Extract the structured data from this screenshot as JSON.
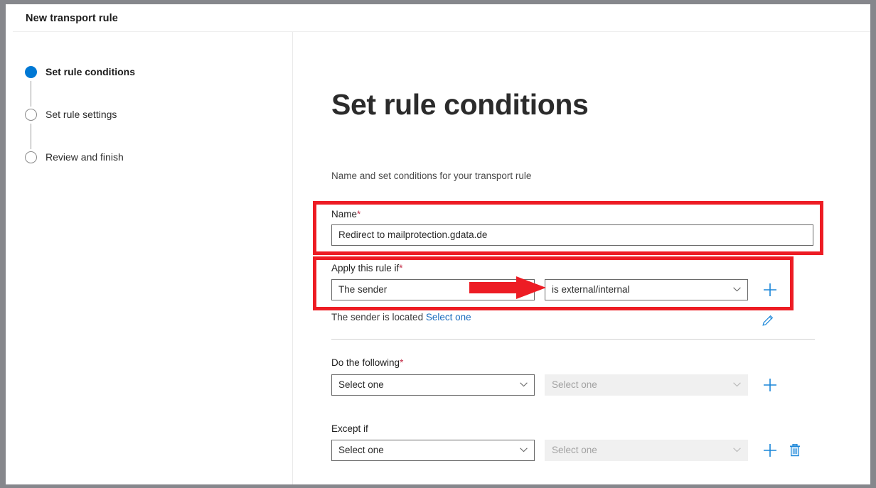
{
  "window": {
    "title": "New transport rule",
    "frame_color": "#86878c"
  },
  "sidebar": {
    "steps": [
      {
        "label": "Set rule conditions",
        "state": "active"
      },
      {
        "label": "Set rule settings",
        "state": "inactive"
      },
      {
        "label": "Review and finish",
        "state": "inactive"
      }
    ]
  },
  "main": {
    "title": "Set rule conditions",
    "subtitle": "Name and set conditions for your transport rule",
    "name_field": {
      "label": "Name",
      "required_marker": "*",
      "value": "Redirect to mailprotection.gdata.de"
    },
    "apply_rule_if": {
      "label": "Apply this rule if",
      "required_marker": "*",
      "condition_value": "The sender",
      "operator_value": "is external/internal",
      "add_label": "+",
      "summary_prefix": "The sender is located",
      "summary_link": "Select one",
      "edit_icon": "pencil-icon"
    },
    "do_the_following": {
      "label": "Do the following",
      "required_marker": "*",
      "action_value": "Select one",
      "detail_value": "Select one",
      "add_label": "+"
    },
    "except_if": {
      "label": "Except if",
      "required_marker": "",
      "action_value": "Select one",
      "detail_value": "Select one",
      "add_label": "+",
      "delete_icon": "trash-icon"
    }
  },
  "annotations": {
    "highlight_color": "#ed1c24",
    "arrow_color": "#ed1c24",
    "boxes": [
      {
        "target": "name-field-group"
      },
      {
        "target": "apply-rule-if-group"
      }
    ],
    "arrows": [
      {
        "target": "operator-dropdown",
        "direction": "right"
      }
    ]
  },
  "colors": {
    "accent": "#0078d4",
    "link": "#1a6bbd",
    "required": "#c4314b",
    "icon_blue": "#1a86d8"
  }
}
